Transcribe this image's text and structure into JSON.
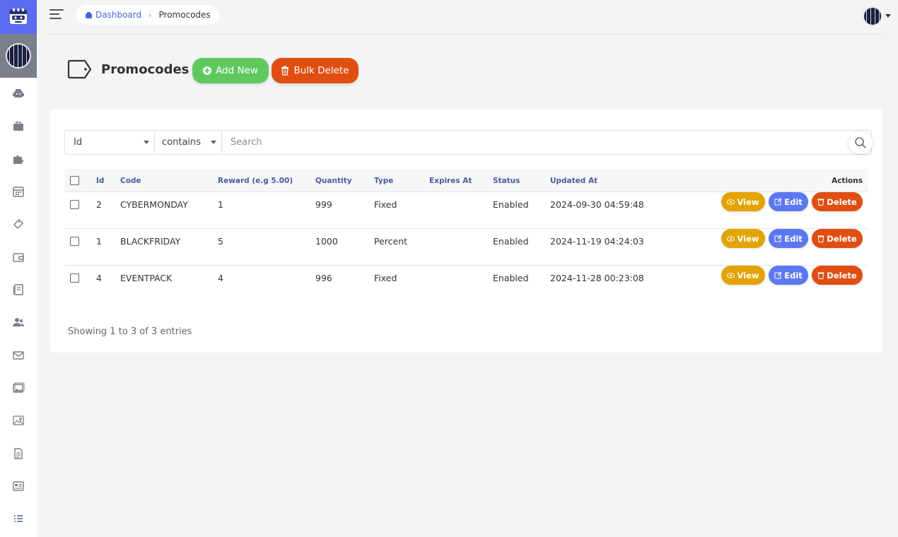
{
  "breadcrumb": {
    "home": "Dashboard",
    "current": "Promocodes"
  },
  "page": {
    "title": "Promocodes",
    "add_label": "Add New",
    "bulk_delete_label": "Bulk Delete"
  },
  "filter": {
    "field": "Id",
    "operator": "contains",
    "search_placeholder": "Search"
  },
  "table": {
    "headers": [
      "Id",
      "Code",
      "Reward (e.g 5.00)",
      "Quantity",
      "Type",
      "Expires At",
      "Status",
      "Updated At",
      "Actions"
    ],
    "rows": [
      {
        "id": "2",
        "code": "CYBERMONDAY",
        "reward": "1",
        "quantity": "999",
        "type": "Fixed",
        "expires": "",
        "status": "Enabled",
        "updated": "2024-09-30 04:59:48"
      },
      {
        "id": "1",
        "code": "BLACKFRIDAY",
        "reward": "5",
        "quantity": "1000",
        "type": "Percent",
        "expires": "",
        "status": "Enabled",
        "updated": "2024-11-19 04:24:03"
      },
      {
        "id": "4",
        "code": "EVENTPACK",
        "reward": "4",
        "quantity": "996",
        "type": "Fixed",
        "expires": "",
        "status": "Enabled",
        "updated": "2024-11-28 00:23:08"
      }
    ],
    "actions": {
      "view": "View",
      "edit": "Edit",
      "delete": "Delete"
    }
  },
  "footer": {
    "info": "Showing 1 to 3 of 3 entries"
  },
  "sidebar_icons": [
    "robot-icon",
    "briefcase-icon",
    "puzzle-icon",
    "calendar-icon",
    "ticket-icon",
    "wallet-icon",
    "book-icon",
    "users-icon",
    "envelope-icon",
    "images-icon",
    "image-icon",
    "document-icon",
    "newspaper-icon",
    "list-icon"
  ],
  "colors": {
    "primary": "#5a6cf0",
    "success": "#5fc95f",
    "danger": "#e04e12",
    "warning": "#e2a400",
    "info": "#5b78f0"
  }
}
